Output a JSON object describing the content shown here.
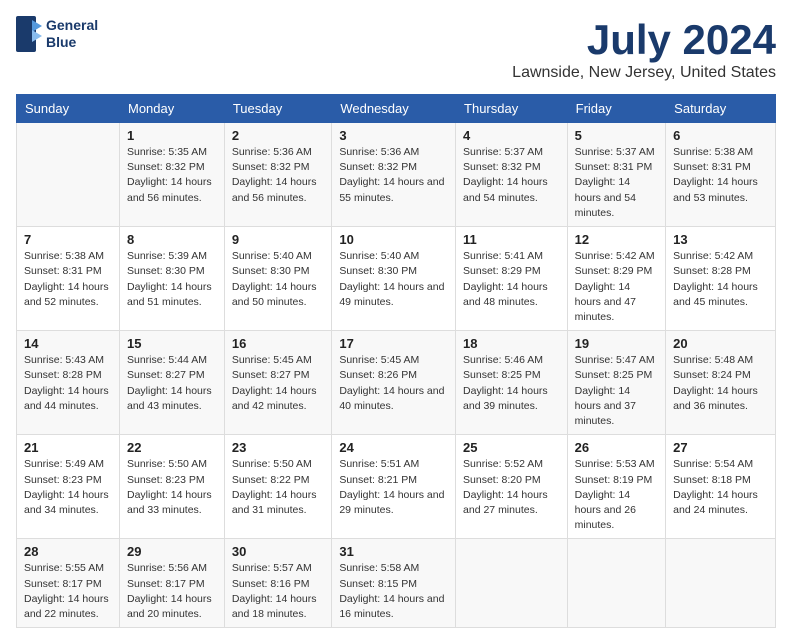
{
  "logo": {
    "line1": "General",
    "line2": "Blue"
  },
  "title": "July 2024",
  "subtitle": "Lawnside, New Jersey, United States",
  "days_header": [
    "Sunday",
    "Monday",
    "Tuesday",
    "Wednesday",
    "Thursday",
    "Friday",
    "Saturday"
  ],
  "weeks": [
    [
      {
        "day": "",
        "info": ""
      },
      {
        "day": "1",
        "info": "Sunrise: 5:35 AM\nSunset: 8:32 PM\nDaylight: 14 hours\nand 56 minutes."
      },
      {
        "day": "2",
        "info": "Sunrise: 5:36 AM\nSunset: 8:32 PM\nDaylight: 14 hours\nand 56 minutes."
      },
      {
        "day": "3",
        "info": "Sunrise: 5:36 AM\nSunset: 8:32 PM\nDaylight: 14 hours\nand 55 minutes."
      },
      {
        "day": "4",
        "info": "Sunrise: 5:37 AM\nSunset: 8:32 PM\nDaylight: 14 hours\nand 54 minutes."
      },
      {
        "day": "5",
        "info": "Sunrise: 5:37 AM\nSunset: 8:31 PM\nDaylight: 14 hours\nand 54 minutes."
      },
      {
        "day": "6",
        "info": "Sunrise: 5:38 AM\nSunset: 8:31 PM\nDaylight: 14 hours\nand 53 minutes."
      }
    ],
    [
      {
        "day": "7",
        "info": "Sunrise: 5:38 AM\nSunset: 8:31 PM\nDaylight: 14 hours\nand 52 minutes."
      },
      {
        "day": "8",
        "info": "Sunrise: 5:39 AM\nSunset: 8:30 PM\nDaylight: 14 hours\nand 51 minutes."
      },
      {
        "day": "9",
        "info": "Sunrise: 5:40 AM\nSunset: 8:30 PM\nDaylight: 14 hours\nand 50 minutes."
      },
      {
        "day": "10",
        "info": "Sunrise: 5:40 AM\nSunset: 8:30 PM\nDaylight: 14 hours\nand 49 minutes."
      },
      {
        "day": "11",
        "info": "Sunrise: 5:41 AM\nSunset: 8:29 PM\nDaylight: 14 hours\nand 48 minutes."
      },
      {
        "day": "12",
        "info": "Sunrise: 5:42 AM\nSunset: 8:29 PM\nDaylight: 14 hours\nand 47 minutes."
      },
      {
        "day": "13",
        "info": "Sunrise: 5:42 AM\nSunset: 8:28 PM\nDaylight: 14 hours\nand 45 minutes."
      }
    ],
    [
      {
        "day": "14",
        "info": "Sunrise: 5:43 AM\nSunset: 8:28 PM\nDaylight: 14 hours\nand 44 minutes."
      },
      {
        "day": "15",
        "info": "Sunrise: 5:44 AM\nSunset: 8:27 PM\nDaylight: 14 hours\nand 43 minutes."
      },
      {
        "day": "16",
        "info": "Sunrise: 5:45 AM\nSunset: 8:27 PM\nDaylight: 14 hours\nand 42 minutes."
      },
      {
        "day": "17",
        "info": "Sunrise: 5:45 AM\nSunset: 8:26 PM\nDaylight: 14 hours\nand 40 minutes."
      },
      {
        "day": "18",
        "info": "Sunrise: 5:46 AM\nSunset: 8:25 PM\nDaylight: 14 hours\nand 39 minutes."
      },
      {
        "day": "19",
        "info": "Sunrise: 5:47 AM\nSunset: 8:25 PM\nDaylight: 14 hours\nand 37 minutes."
      },
      {
        "day": "20",
        "info": "Sunrise: 5:48 AM\nSunset: 8:24 PM\nDaylight: 14 hours\nand 36 minutes."
      }
    ],
    [
      {
        "day": "21",
        "info": "Sunrise: 5:49 AM\nSunset: 8:23 PM\nDaylight: 14 hours\nand 34 minutes."
      },
      {
        "day": "22",
        "info": "Sunrise: 5:50 AM\nSunset: 8:23 PM\nDaylight: 14 hours\nand 33 minutes."
      },
      {
        "day": "23",
        "info": "Sunrise: 5:50 AM\nSunset: 8:22 PM\nDaylight: 14 hours\nand 31 minutes."
      },
      {
        "day": "24",
        "info": "Sunrise: 5:51 AM\nSunset: 8:21 PM\nDaylight: 14 hours\nand 29 minutes."
      },
      {
        "day": "25",
        "info": "Sunrise: 5:52 AM\nSunset: 8:20 PM\nDaylight: 14 hours\nand 27 minutes."
      },
      {
        "day": "26",
        "info": "Sunrise: 5:53 AM\nSunset: 8:19 PM\nDaylight: 14 hours\nand 26 minutes."
      },
      {
        "day": "27",
        "info": "Sunrise: 5:54 AM\nSunset: 8:18 PM\nDaylight: 14 hours\nand 24 minutes."
      }
    ],
    [
      {
        "day": "28",
        "info": "Sunrise: 5:55 AM\nSunset: 8:17 PM\nDaylight: 14 hours\nand 22 minutes."
      },
      {
        "day": "29",
        "info": "Sunrise: 5:56 AM\nSunset: 8:17 PM\nDaylight: 14 hours\nand 20 minutes."
      },
      {
        "day": "30",
        "info": "Sunrise: 5:57 AM\nSunset: 8:16 PM\nDaylight: 14 hours\nand 18 minutes."
      },
      {
        "day": "31",
        "info": "Sunrise: 5:58 AM\nSunset: 8:15 PM\nDaylight: 14 hours\nand 16 minutes."
      },
      {
        "day": "",
        "info": ""
      },
      {
        "day": "",
        "info": ""
      },
      {
        "day": "",
        "info": ""
      }
    ]
  ]
}
